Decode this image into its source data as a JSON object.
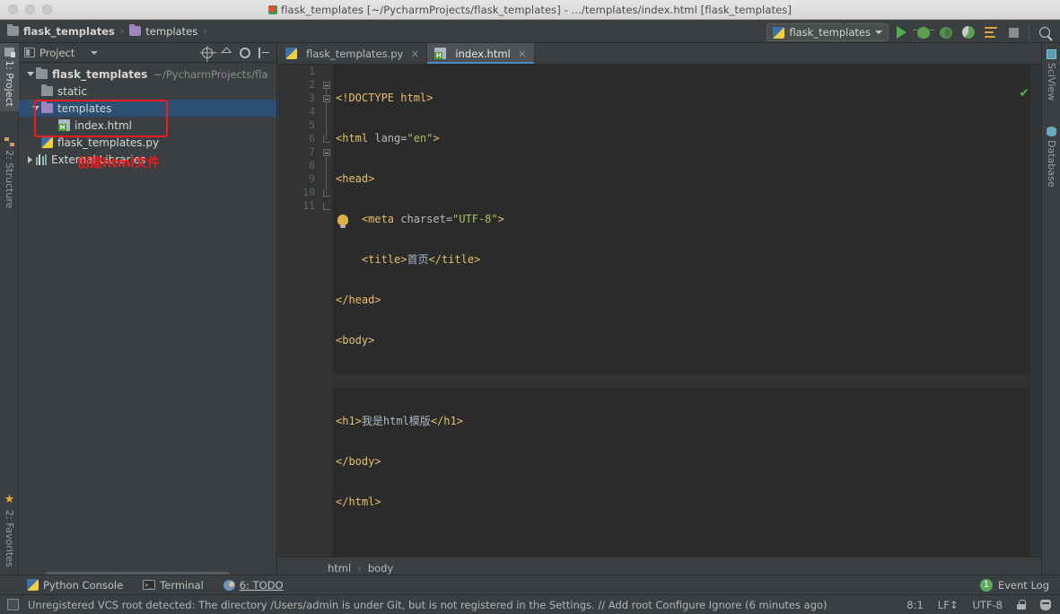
{
  "window": {
    "title": "flask_templates [~/PycharmProjects/flask_templates] - .../templates/index.html [flask_templates]"
  },
  "breadcrumb_top": {
    "items": [
      {
        "label": "flask_templates",
        "icon": "folder-icon"
      },
      {
        "label": "templates",
        "icon": "folder-icon"
      }
    ],
    "separator": "›"
  },
  "toolbar": {
    "run_config": "flask_templates",
    "buttons": [
      {
        "name": "run-button",
        "label": "Run"
      },
      {
        "name": "debug-button",
        "label": "Debug"
      },
      {
        "name": "coverage-button",
        "label": "Run with Coverage"
      },
      {
        "name": "profile-button",
        "label": "Profile"
      },
      {
        "name": "run-dashboard-button",
        "label": "Run Dashboard"
      },
      {
        "name": "stop-button",
        "label": "Stop"
      },
      {
        "name": "search-everywhere-button",
        "label": "Search Everywhere"
      }
    ]
  },
  "left_rail": {
    "tabs": [
      {
        "label": "1: Project",
        "active": true
      },
      {
        "label": "2: Structure",
        "active": false
      }
    ],
    "bottom_tabs": [
      {
        "label": "2: Favorites",
        "active": false
      }
    ]
  },
  "right_rail": {
    "tabs": [
      {
        "label": "SciView"
      },
      {
        "label": "Database"
      }
    ]
  },
  "project_panel": {
    "title": "Project",
    "tools": [
      {
        "name": "select-opened-file-button",
        "label": "Select Opened File"
      },
      {
        "name": "collapse-all-button",
        "label": "Collapse All"
      },
      {
        "name": "settings-gear-button",
        "label": "Settings"
      },
      {
        "name": "hide-panel-button",
        "label": "Hide"
      }
    ],
    "tree": [
      {
        "label": "flask_templates",
        "path": "~/PycharmProjects/fla",
        "icon": "folder-icon",
        "indent": 0,
        "arrow": "down",
        "bold": true,
        "selected": false
      },
      {
        "label": "static",
        "path": "",
        "icon": "folder-icon",
        "indent": 1,
        "arrow": "none",
        "bold": false,
        "selected": false
      },
      {
        "label": "templates",
        "path": "",
        "icon": "folder-purple-icon",
        "indent": 1,
        "arrow": "down",
        "bold": false,
        "selected": true
      },
      {
        "label": "index.html",
        "path": "",
        "icon": "html-file-icon",
        "indent": 2,
        "arrow": "none",
        "bold": false,
        "selected": false
      },
      {
        "label": "flask_templates.py",
        "path": "",
        "icon": "python-file-icon",
        "indent": 1,
        "arrow": "none",
        "bold": false,
        "selected": false
      },
      {
        "label": "External Libraries",
        "path": "",
        "icon": "library-icon",
        "indent": 0,
        "arrow": "right",
        "bold": false,
        "selected": false
      }
    ]
  },
  "annotation": {
    "text": "创建html文件",
    "color": "#ee1c1c"
  },
  "editor": {
    "tabs": [
      {
        "label": "flask_templates.py",
        "icon": "python-file-icon",
        "active": false,
        "close": "×"
      },
      {
        "label": "index.html",
        "icon": "html-file-icon",
        "active": true,
        "close": "×"
      }
    ],
    "line_numbers": [
      "1",
      "2",
      "3",
      "4",
      "5",
      "6",
      "7",
      "8",
      "9",
      "10",
      "11"
    ],
    "code_lines": [
      {
        "n": 1,
        "current": false,
        "tokens": [
          {
            "t": "<!DOCTYPE html>",
            "c": "tag"
          }
        ]
      },
      {
        "n": 2,
        "current": false,
        "tokens": [
          {
            "t": "<html ",
            "c": "tag"
          },
          {
            "t": "lang=",
            "c": "attr"
          },
          {
            "t": "\"en\"",
            "c": "str"
          },
          {
            "t": ">",
            "c": "tag"
          }
        ]
      },
      {
        "n": 3,
        "current": false,
        "tokens": [
          {
            "t": "<head>",
            "c": "tag"
          }
        ]
      },
      {
        "n": 4,
        "current": false,
        "tokens": [
          {
            "t": "    <meta ",
            "c": "tag"
          },
          {
            "t": "charset=",
            "c": "attr"
          },
          {
            "t": "\"UTF-8\"",
            "c": "str"
          },
          {
            "t": ">",
            "c": "tag"
          }
        ]
      },
      {
        "n": 5,
        "current": false,
        "tokens": [
          {
            "t": "    <title>",
            "c": "tag"
          },
          {
            "t": "首页",
            "c": "txt"
          },
          {
            "t": "</title>",
            "c": "tag"
          }
        ]
      },
      {
        "n": 6,
        "current": false,
        "tokens": [
          {
            "t": "</head>",
            "c": "tag"
          }
        ]
      },
      {
        "n": 7,
        "current": false,
        "tokens": [
          {
            "t": "<body>",
            "c": "tag"
          }
        ]
      },
      {
        "n": 8,
        "current": true,
        "tokens": [
          {
            "t": "",
            "c": "txt"
          }
        ]
      },
      {
        "n": 9,
        "current": false,
        "tokens": [
          {
            "t": "<h1>",
            "c": "tag"
          },
          {
            "t": "我是html模版",
            "c": "txt"
          },
          {
            "t": "</h1>",
            "c": "tag"
          }
        ]
      },
      {
        "n": 10,
        "current": false,
        "tokens": [
          {
            "t": "</body>",
            "c": "tag"
          }
        ]
      },
      {
        "n": 11,
        "current": false,
        "tokens": [
          {
            "t": "</html>",
            "c": "tag"
          }
        ]
      }
    ],
    "inspection_status": "✔",
    "breadcrumb": {
      "items": [
        "html",
        "body"
      ],
      "separator": "›"
    }
  },
  "bottom_bar": {
    "items": [
      {
        "label": "Python Console",
        "icon": "python-console-icon"
      },
      {
        "label": "Terminal",
        "icon": "terminal-icon"
      },
      {
        "label": "6: TODO",
        "icon": "todo-icon"
      }
    ],
    "event_log": {
      "label": "Event Log",
      "count": "1"
    }
  },
  "status_bar": {
    "message": "Unregistered VCS root detected: The directory /Users/admin is under Git, but is not registered in the Settings. // Add root  Configure  Ignore (6 minutes ago)",
    "caret_position": "8:1",
    "line_separator": "LF↕",
    "encoding": "UTF-8",
    "icons": [
      {
        "name": "lock-icon",
        "label": "Read-only toggle"
      },
      {
        "name": "inspections-icon",
        "label": "Inspections"
      }
    ]
  }
}
